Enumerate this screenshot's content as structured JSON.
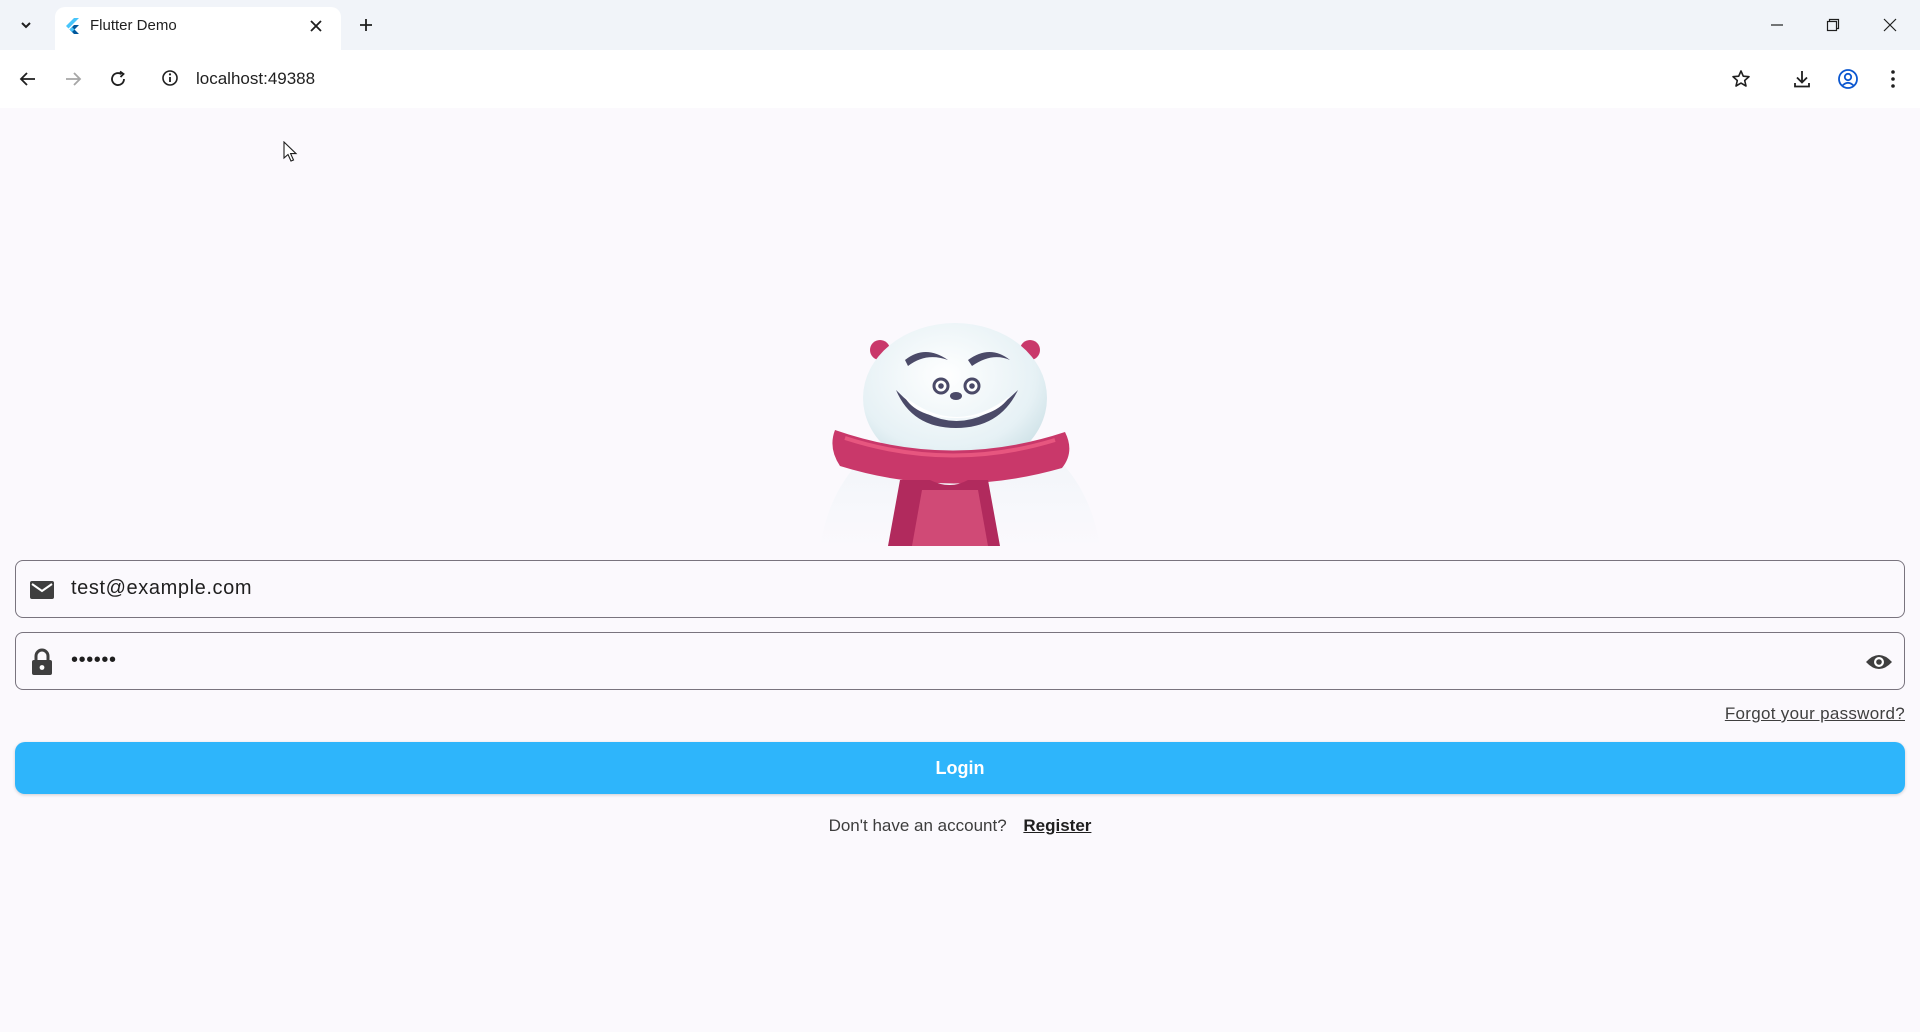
{
  "browser": {
    "tab_title": "Flutter Demo",
    "url": "localhost:49388",
    "icons": {
      "tab_search": "chevron-down-icon",
      "favicon": "flutter-logo-icon",
      "tab_close": "close-icon",
      "new_tab": "plus-icon",
      "minimize": "minimize-icon",
      "restore": "restore-icon",
      "close_window": "close-icon",
      "back": "arrow-left-icon",
      "forward": "arrow-right-icon",
      "reload": "reload-icon",
      "site_info": "info-icon",
      "bookmark": "star-icon",
      "downloads": "download-icon",
      "profile": "profile-icon",
      "menu": "kebab-menu-icon"
    }
  },
  "login": {
    "email_value": "test@example.com",
    "password_value": "••••••",
    "forgot_password": "Forgot your password?",
    "login_button": "Login",
    "no_account_text": "Don't have an account?",
    "register_link": "Register"
  },
  "colors": {
    "primary_button": "#2eb5fb",
    "background": "#fbf9fd",
    "field_border": "#79747e"
  }
}
